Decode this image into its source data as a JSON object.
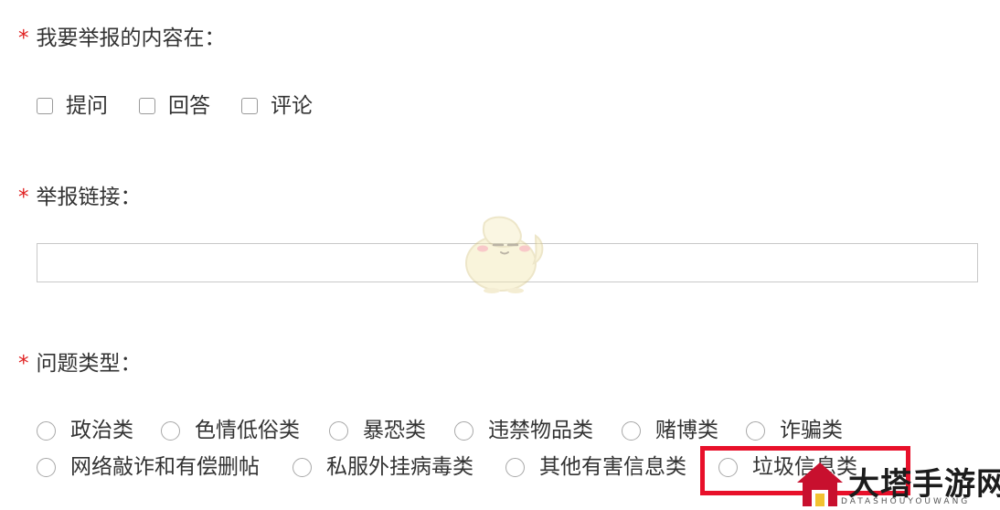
{
  "section_report_content": {
    "required_mark": "*",
    "label": "我要举报的内容在：",
    "options": [
      "提问",
      "回答",
      "评论"
    ]
  },
  "section_report_link": {
    "required_mark": "*",
    "label": "举报链接：",
    "input_value": ""
  },
  "section_issue_type": {
    "required_mark": "*",
    "label": "问题类型：",
    "options": [
      "政治类",
      "色情低俗类",
      "暴恐类",
      "违禁物品类",
      "赌博类",
      "诈骗类",
      "网络敲诈和有偿删帖",
      "私服外挂病毒类",
      "其他有害信息类",
      "垃圾信息类"
    ]
  },
  "highlight_color": "#e8102a",
  "watermark": {
    "title": "大塔手游网",
    "subtitle": "DATASHOUYOUWANG"
  }
}
